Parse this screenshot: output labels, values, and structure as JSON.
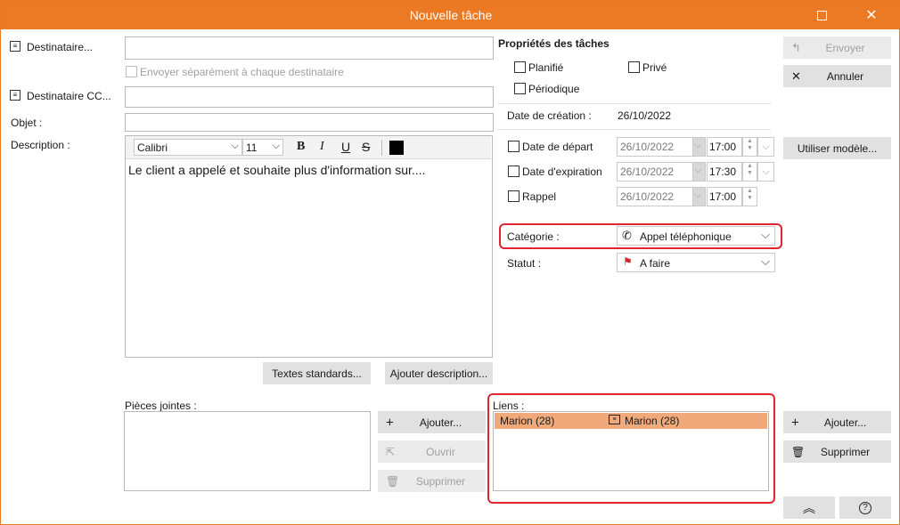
{
  "window": {
    "title": "Nouvelle tâche"
  },
  "left": {
    "recipient_label": "Destinataire...",
    "send_separately_label": "Envoyer séparément à chaque destinataire",
    "cc_label": "Destinataire CC...",
    "subject_label": "Objet :",
    "description_label": "Description :",
    "font_name": "Calibri",
    "font_size": "11",
    "bold": "B",
    "italic": "I",
    "underline": "U",
    "strike": "S",
    "description_text": "Le client a appelé et souhaite plus d'information sur....",
    "standard_texts_button": "Textes standards...",
    "add_description_button": "Ajouter description...",
    "attachments_label": "Pièces jointes :",
    "attach_add_button": "Ajouter...",
    "attach_open_button": "Ouvrir",
    "attach_delete_button": "Supprimer"
  },
  "props": {
    "heading": "Propriétés des tâches",
    "planned_label": "Planifié",
    "private_label": "Privé",
    "periodic_label": "Périodique",
    "creation_date_label": "Date de création :",
    "creation_date_value": "26/10/2022",
    "start_date_label": "Date de départ",
    "start_date_value": "26/10/2022",
    "start_time_value": "17:00",
    "expiry_date_label": "Date d'expiration",
    "expiry_date_value": "26/10/2022",
    "expiry_time_value": "17:30",
    "reminder_label": "Rappel",
    "reminder_date_value": "26/10/2022",
    "reminder_time_value": "17:00",
    "category_label": "Catégorie :",
    "category_value": "Appel téléphonique",
    "status_label": "Statut :",
    "status_value": "A faire"
  },
  "links": {
    "label": "Liens :",
    "rows": [
      {
        "from": "Marion (28)",
        "to": "Marion (28)"
      }
    ],
    "add_button": "Ajouter...",
    "delete_button": "Supprimer"
  },
  "right": {
    "send_button": "Envoyer",
    "cancel_button": "Annuler",
    "use_template_button": "Utiliser modèle..."
  },
  "colors": {
    "accent": "#ec7a24",
    "highlight": "#e0252e",
    "link_row": "#f0a97a"
  }
}
